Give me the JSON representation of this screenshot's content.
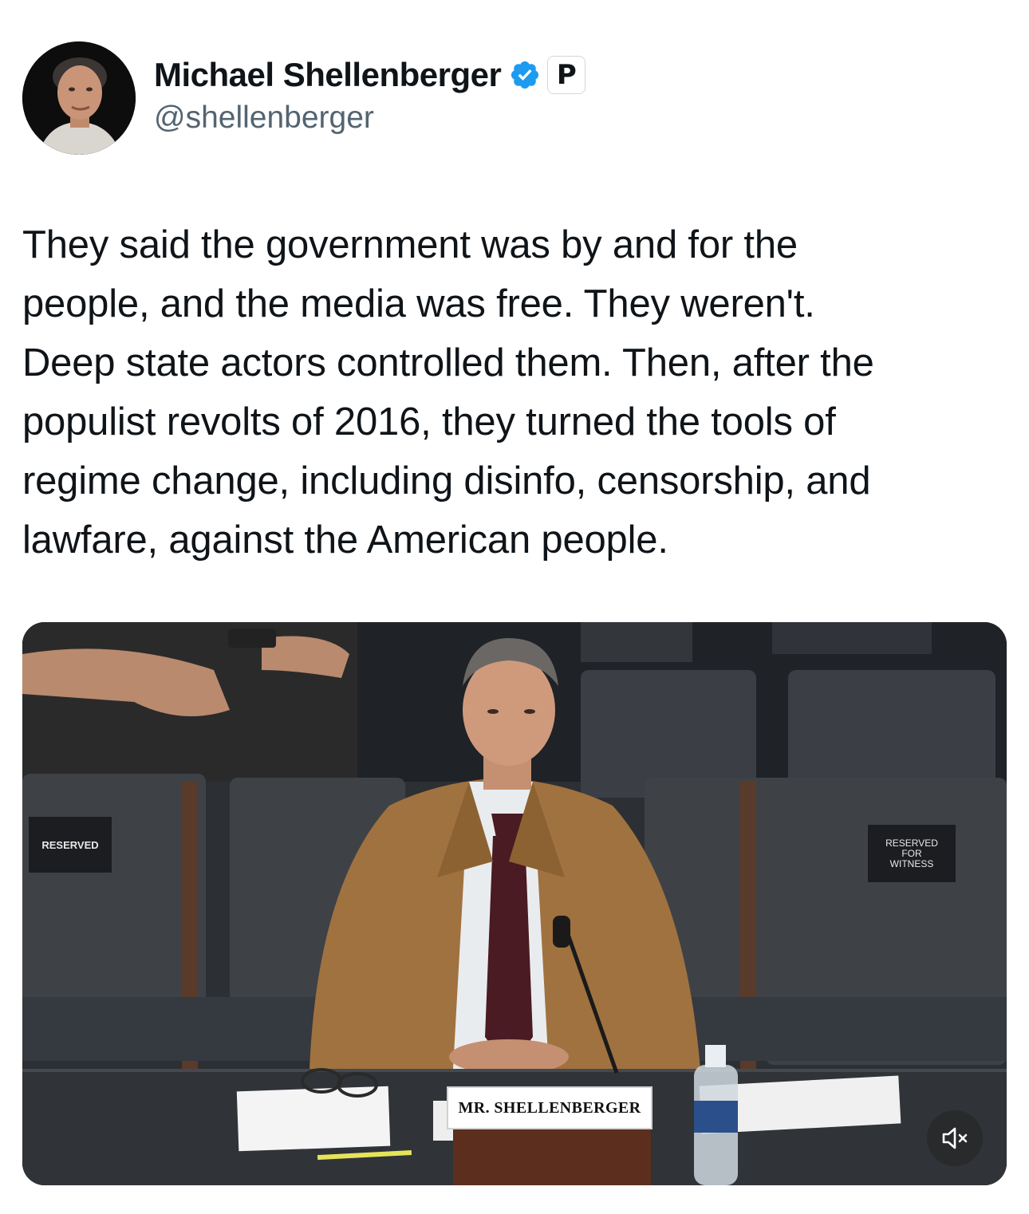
{
  "author": {
    "display_name": "Michael Shellenberger",
    "handle": "@shellenberger",
    "affiliation_badge": "P",
    "avatar_icon": "profile-photo",
    "verified_icon": "verified-badge-icon",
    "verified_color": "#1d9bf0"
  },
  "tweet": {
    "text_lines": [
      "They said the government was by and for the",
      "people, and the media was free. They weren't.",
      "Deep state actors controlled them. Then, after the",
      "populist revolts of 2016, they turned the tools of",
      "regime change, including disinfo, censorship, and",
      "lawfare, against the American people."
    ]
  },
  "media": {
    "type": "video",
    "sign_left": "RESERVED",
    "sign_right_lines": [
      "RESERVED",
      "FOR",
      "WITNESS"
    ],
    "nameplate": "MR. SHELLENBERGER",
    "mute_icon": "speaker-muted-icon"
  },
  "colors": {
    "text_primary": "#0f1419",
    "text_secondary": "#536471",
    "suit": "#a0723f",
    "tie": "#4a1b22"
  }
}
